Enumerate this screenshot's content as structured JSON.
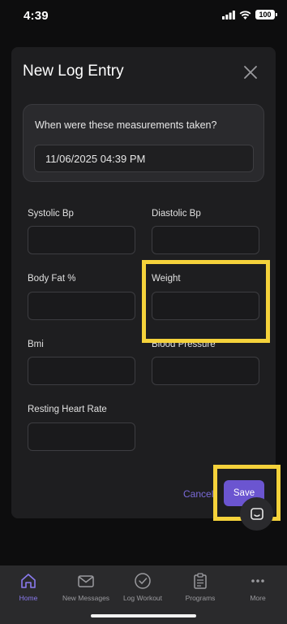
{
  "status_bar": {
    "time": "4:39",
    "battery": "100"
  },
  "modal": {
    "title": "New Log Entry",
    "date_question": "When were these measurements taken?",
    "date_value": "11/06/2025 04:39 PM",
    "fields": [
      {
        "label": "Systolic Bp",
        "value": ""
      },
      {
        "label": "Diastolic Bp",
        "value": ""
      },
      {
        "label": "Body Fat %",
        "value": ""
      },
      {
        "label": "Weight",
        "value": ""
      },
      {
        "label": "Bmi",
        "value": ""
      },
      {
        "label": "Blood Pressure",
        "value": ""
      },
      {
        "label": "Resting Heart Rate",
        "value": ""
      }
    ],
    "cancel_label": "Cancel",
    "save_label": "Save"
  },
  "tabs": [
    {
      "label": "Home",
      "icon": "home-icon",
      "active": true
    },
    {
      "label": "New Messages",
      "icon": "mail-icon",
      "active": false
    },
    {
      "label": "Log Workout",
      "icon": "check-circle-icon",
      "active": false
    },
    {
      "label": "Programs",
      "icon": "clipboard-icon",
      "active": false
    },
    {
      "label": "More",
      "icon": "more-dots-icon",
      "active": false
    }
  ],
  "colors": {
    "accent": "#6b55d0",
    "highlight": "#f5d23b",
    "active_tab": "#8b7bf0",
    "modal_bg": "#1e1e20"
  }
}
